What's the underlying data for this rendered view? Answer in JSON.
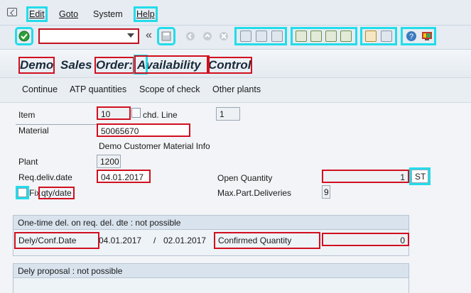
{
  "menu": {
    "edit": "Edit",
    "goto": "Goto",
    "system": "System",
    "help": "Help"
  },
  "title": {
    "parts": [
      "Demo",
      "Sales",
      "Order:",
      "Availability",
      "Control"
    ]
  },
  "app_toolbar": {
    "continue": "Continue",
    "atp": "ATP quantities",
    "scope": "Scope of check",
    "other_plants": "Other plants"
  },
  "form": {
    "item_label": "Item",
    "item_value": "10",
    "schd_line_label": "chd. Line",
    "schd_line_value": "1",
    "material_label": "Material",
    "material_value": "50065670",
    "customer_material_info": "Demo Customer Material Info",
    "plant_label": "Plant",
    "plant_value": "1200",
    "req_deliv_date_label": "Req.deliv.date",
    "req_deliv_date_value": "04.01.2017",
    "open_qty_label": "Open Quantity",
    "open_qty_value": "1",
    "open_qty_unit": "ST",
    "fix_label": "Fix",
    "qty_date_label": "qty/date",
    "max_part_label": "Max.Part.Deliveries",
    "max_part_value": "9"
  },
  "one_time": {
    "header": "One-time del. on req. del. dte : not possible",
    "dely_conf_label": "Dely/Conf.Date",
    "dely_date": "04.01.2017",
    "separator": "/",
    "conf_date": "02.01.2017",
    "confirmed_qty_label": "Confirmed Quantity",
    "confirmed_qty_value": "0"
  },
  "proposal": {
    "header": "Dely proposal : not possible"
  },
  "colors": {
    "highlight_cyan": "#22dcea",
    "highlight_red": "#d10f1f"
  }
}
